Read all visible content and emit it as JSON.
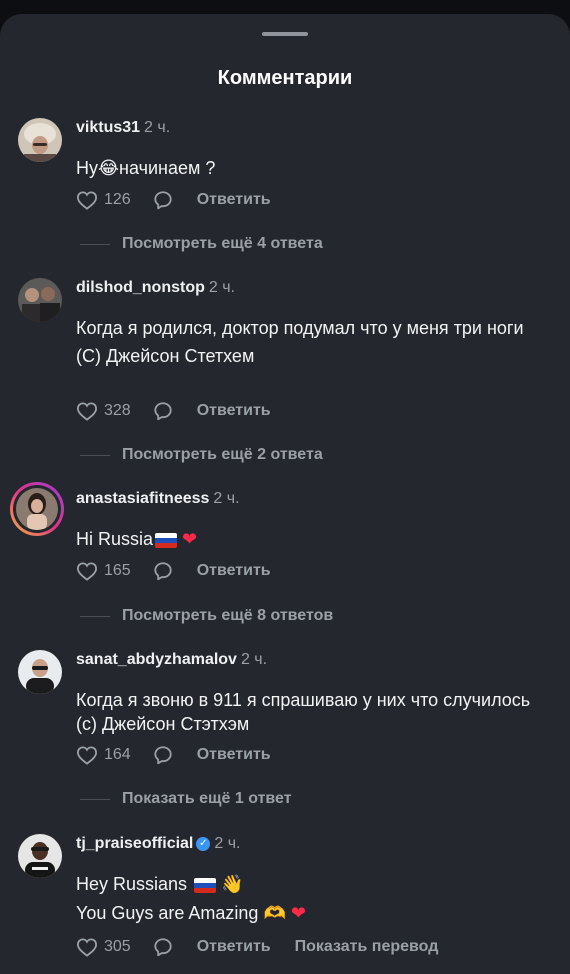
{
  "header": {
    "title": "Комментарии"
  },
  "actions": {
    "reply_label": "Ответить",
    "translate_label": "Показать перевод"
  },
  "comments": [
    {
      "username": "viktus31",
      "time": "2 ч.",
      "lines": [
        "Ну",
        "начинаем ?"
      ],
      "likes": "126",
      "more_label": "Посмотреть ещё 4 ответа"
    },
    {
      "username": "dilshod_nonstop",
      "time": "2 ч.",
      "lines": [
        "Когда я родился, доктор подумал что у меня три ноги",
        "(С) Джейсон Стетхем"
      ],
      "likes": "328",
      "more_label": "Посмотреть ещё 2 ответа"
    },
    {
      "username": "anastasiafitneess",
      "time": "2 ч.",
      "lines": [
        "Hi Russia"
      ],
      "likes": "165",
      "more_label": "Посмотреть ещё 8 ответов"
    },
    {
      "username": "sanat_abdyzhamalov",
      "time": "2 ч.",
      "lines": [
        "Когда я звоню в 911 я спрашиваю у них что случилось (с) Джейсон Стэтхэм"
      ],
      "likes": "164",
      "more_label": "Показать ещё 1 ответ"
    },
    {
      "username": "tj_praiseofficial",
      "time": "2 ч.",
      "lines": [
        "Hey Russians",
        "You Guys are Amazing"
      ],
      "likes": "305",
      "verified": true
    }
  ],
  "colors": {
    "background": "#24272d",
    "text_primary": "#f2f3f5",
    "text_secondary": "#9aa0a8",
    "verified_badge": "#3a96f5"
  },
  "icons": [
    "heart-outline-icon",
    "comment-bubble-icon",
    "verified-badge-icon"
  ]
}
